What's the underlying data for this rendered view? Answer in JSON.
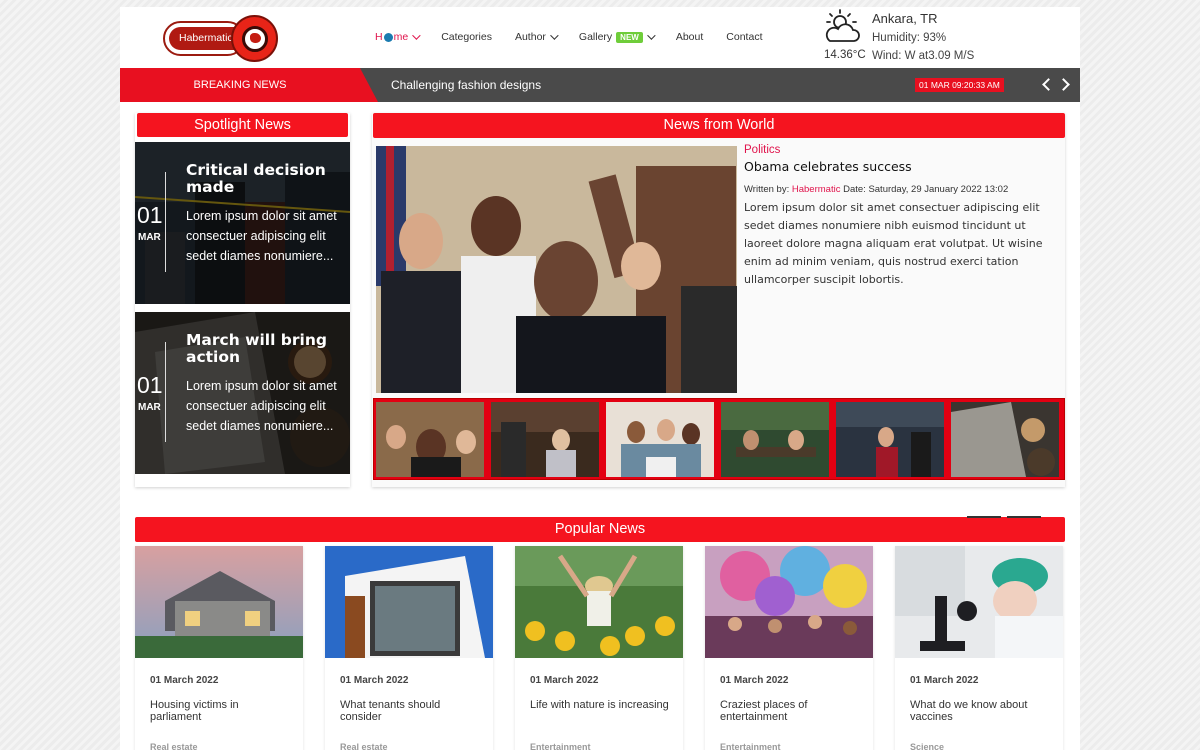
{
  "logo": {
    "text": "Habermatic"
  },
  "nav": {
    "home": [
      "H",
      "me"
    ],
    "categories": "Categories",
    "author": "Author",
    "gallery": "Gallery",
    "gallery_badge": "NEW",
    "about": "About",
    "contact": "Contact"
  },
  "weather": {
    "city": "Ankara, TR",
    "humidity": "Humidity: 93%",
    "wind": "Wind: W at3.09 M/S",
    "temp": "14.36°C",
    "icon": "partly-cloudy-icon"
  },
  "ticker": {
    "label": "BREAKING NEWS",
    "headline": "Challenging fashion designs",
    "datetime": "01 MAR 09:20:33 AM"
  },
  "spotlight": {
    "title": "Spotlight News",
    "items": [
      {
        "day": "01",
        "month": "MAR",
        "title": "Critical decision made",
        "excerpt": "Lorem ipsum dolor sit amet consectuer adipiscing elit sedet diames nonumiere..."
      },
      {
        "day": "01",
        "month": "MAR",
        "title": "March will bring action",
        "excerpt": "Lorem ipsum dolor sit amet consectuer adipiscing elit sedet diames nonumiere..."
      }
    ]
  },
  "world": {
    "title": "News from World",
    "category": "Politics",
    "headline": "Obama celebrates success",
    "written_by": "Written by:",
    "author": "Habermatic",
    "date": "Date: Saturday, 29 January 2022 13:02",
    "body": "Lorem ipsum dolor sit amet consectuer adipiscing elit sedet diames nonumiere nibh euismod tincidunt ut laoreet dolore magna aliquam erat volutpat. Ut wisine enim ad minim veniam, quis nostrud exerci tation ullamcorper suscipit lobortis."
  },
  "popular": {
    "title": "Popular News",
    "cards": [
      {
        "date": "01 March 2022",
        "title": "Housing victims in parliament",
        "category": "Real estate"
      },
      {
        "date": "01 March 2022",
        "title": "What tenants should consider",
        "category": "Real estate"
      },
      {
        "date": "01 March 2022",
        "title": "Life with nature is increasing",
        "category": "Entertainment"
      },
      {
        "date": "01 March 2022",
        "title": "Craziest places of entertainment",
        "category": "Entertainment"
      },
      {
        "date": "01 March 2022",
        "title": "What do we know about vaccines",
        "category": "Science"
      }
    ]
  }
}
